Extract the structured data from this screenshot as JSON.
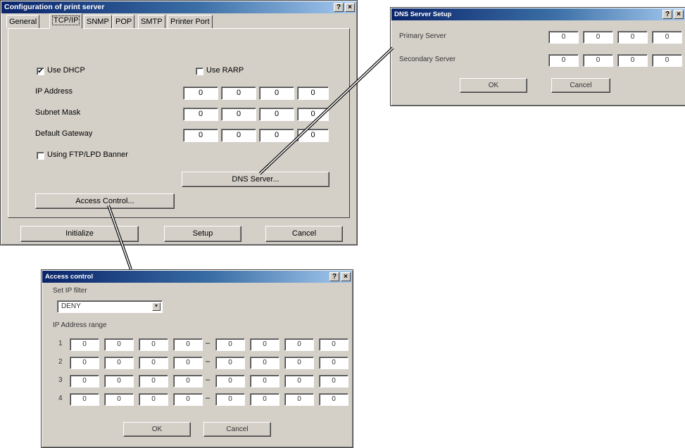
{
  "main": {
    "title": "Configuration of print server",
    "help": "?",
    "close": "×",
    "tabs": [
      "General",
      "TCP/IP",
      "SNMP",
      "POP",
      "SMTP",
      "Printer Port"
    ],
    "use_dhcp": "Use DHCP",
    "use_rarp": "Use RARP",
    "ip_label": "IP Address",
    "subnet_label": "Subnet Mask",
    "gateway_label": "Default Gateway",
    "banner_label": "Using FTP/LPD Banner",
    "ip": [
      "0",
      "0",
      "0",
      "0"
    ],
    "subnet": [
      "0",
      "0",
      "0",
      "0"
    ],
    "gateway": [
      "0",
      "0",
      "0",
      "0"
    ],
    "dns_button": "DNS Server...",
    "access_button": "Access Control...",
    "initialize": "Initialize",
    "setup": "Setup",
    "cancel": "Cancel",
    "dhcp_checked": true,
    "rarp_checked": false,
    "banner_checked": false
  },
  "dns": {
    "title": "DNS Server Setup",
    "help": "?",
    "close": "×",
    "primary_label": "Primary Server",
    "secondary_label": "Secondary Server",
    "primary": [
      "0",
      "0",
      "0",
      "0"
    ],
    "secondary": [
      "0",
      "0",
      "0",
      "0"
    ],
    "ok": "OK",
    "cancel": "Cancel"
  },
  "access": {
    "title": "Access control",
    "help": "?",
    "close": "×",
    "filter_label": "Set IP filter",
    "filter_value": "DENY",
    "range_label": "IP Address range",
    "rows": [
      {
        "num": "1",
        "from": [
          "0",
          "0",
          "0",
          "0"
        ],
        "to": [
          "0",
          "0",
          "0",
          "0"
        ]
      },
      {
        "num": "2",
        "from": [
          "0",
          "0",
          "0",
          "0"
        ],
        "to": [
          "0",
          "0",
          "0",
          "0"
        ]
      },
      {
        "num": "3",
        "from": [
          "0",
          "0",
          "0",
          "0"
        ],
        "to": [
          "0",
          "0",
          "0",
          "0"
        ]
      },
      {
        "num": "4",
        "from": [
          "0",
          "0",
          "0",
          "0"
        ],
        "to": [
          "0",
          "0",
          "0",
          "0"
        ]
      }
    ],
    "dash": "–",
    "ok": "OK",
    "cancel": "Cancel"
  },
  "icons": {
    "check": "✔",
    "dropdown_arrow": "▼"
  }
}
